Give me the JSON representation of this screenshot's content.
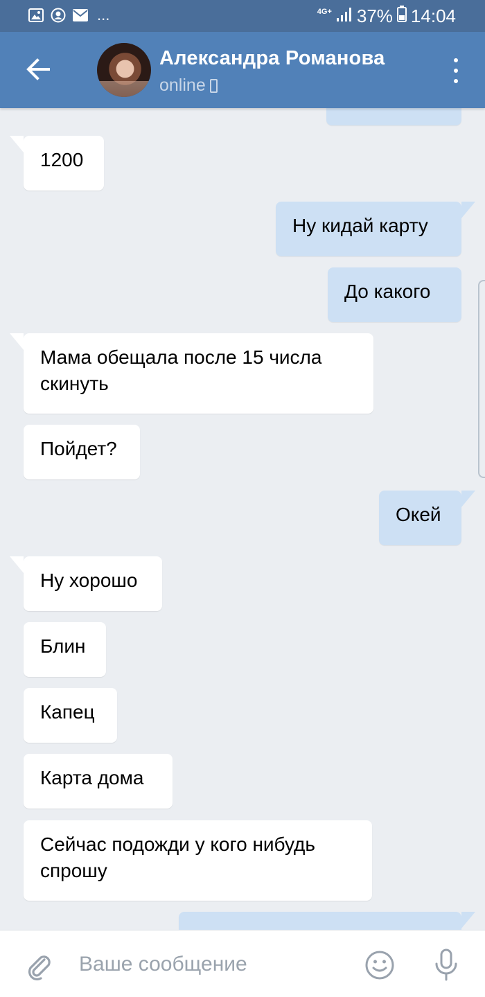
{
  "status_bar": {
    "network": "4G+",
    "battery": "37%",
    "time": "14:04",
    "more": "..."
  },
  "header": {
    "name": "Александра Романова",
    "status": "online"
  },
  "messages": [
    {
      "dir": "in",
      "text": "1200"
    },
    {
      "dir": "out",
      "text": "Ну кидай карту"
    },
    {
      "dir": "out",
      "text": "До какого"
    },
    {
      "dir": "in",
      "text": "Мама обещала после 15 числа скинуть"
    },
    {
      "dir": "in",
      "text": "Пойдет?"
    },
    {
      "dir": "out",
      "text": "Окей"
    },
    {
      "dir": "in",
      "text": "Ну хорошо"
    },
    {
      "dir": "in",
      "text": "Блин"
    },
    {
      "dir": "in",
      "text": "Капец"
    },
    {
      "dir": "in",
      "text": "Карта дома"
    },
    {
      "dir": "in",
      "text": "Сейчас подожди у кого нибудь спрошу"
    }
  ],
  "input": {
    "placeholder": "Ваше сообщение"
  },
  "colors": {
    "header": "#5181b8",
    "status_bar": "#4a6e9a",
    "outgoing_bubble": "#cde0f4",
    "incoming_bubble": "#ffffff",
    "background": "#ebeef2"
  }
}
